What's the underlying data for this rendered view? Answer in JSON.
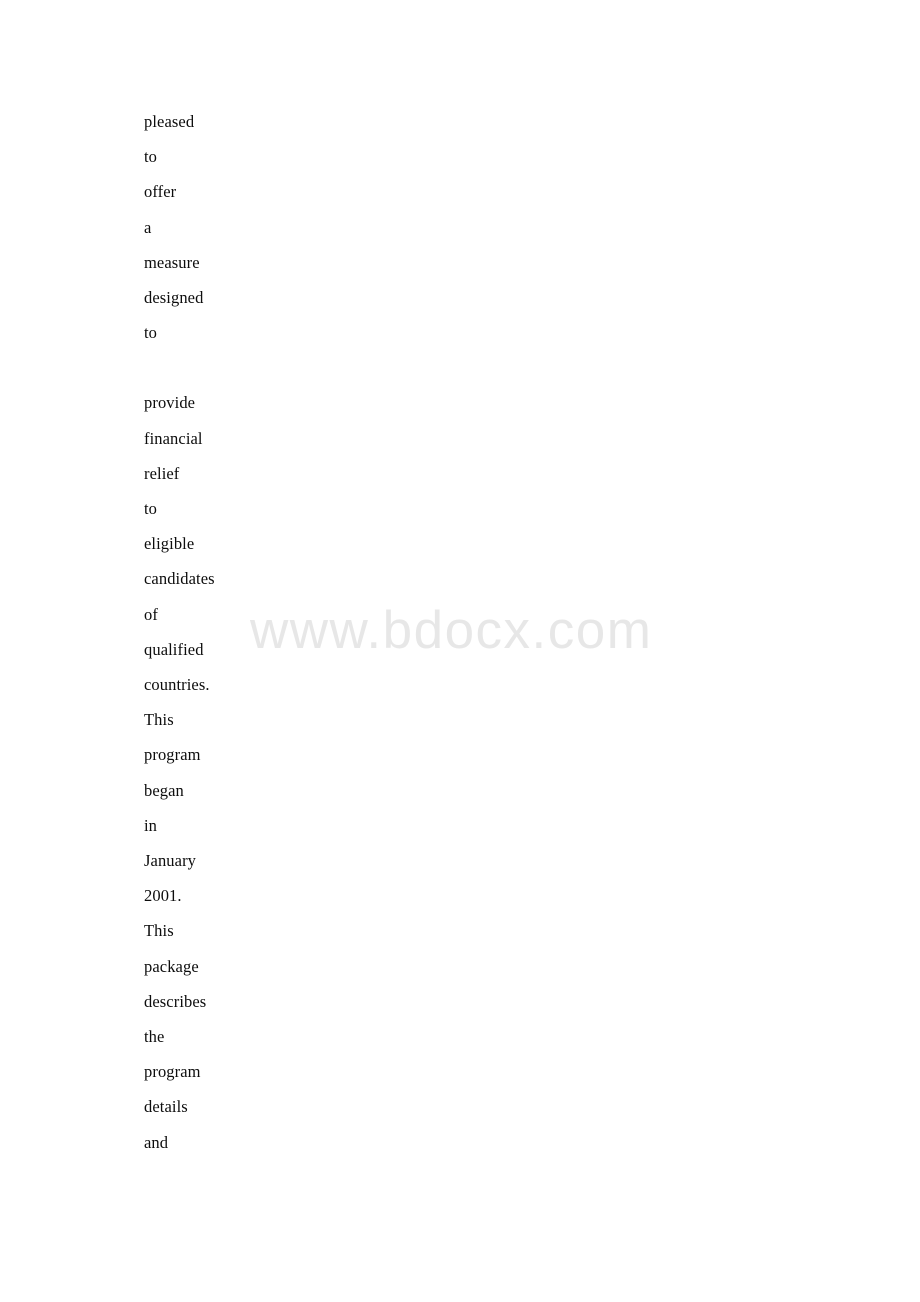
{
  "document": {
    "page_background": "#ffffff",
    "text_color": "#0d0d0d"
  },
  "watermark": {
    "text": "www.bdocx.com",
    "color": "#e7e7e7"
  },
  "body": {
    "blocks": [
      {
        "id": "block-1",
        "lines": [
          "pleased",
          "to",
          "offer",
          "a",
          "measure",
          "designed",
          "to"
        ]
      },
      {
        "id": "block-2",
        "lines": [
          "provide",
          "financial",
          "relief",
          "to",
          "eligible",
          "candidates",
          "of",
          "qualified",
          "countries.",
          "This",
          "program",
          "began",
          "in",
          "January",
          "2001.",
          "This",
          "package",
          "describes",
          "the",
          "program",
          "details",
          "and"
        ]
      }
    ]
  }
}
